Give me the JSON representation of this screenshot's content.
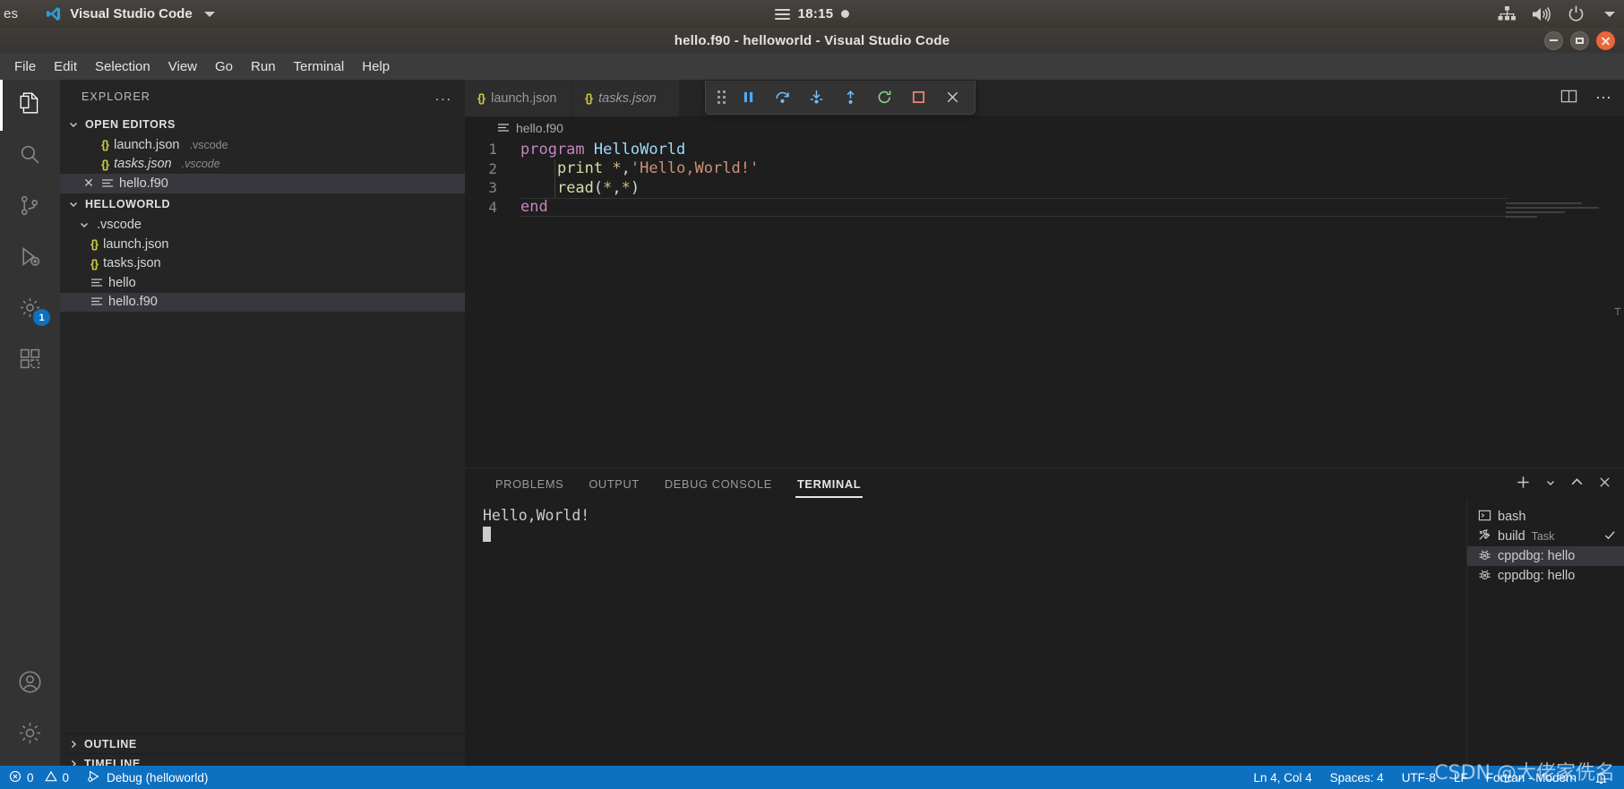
{
  "gnome_panel": {
    "activities": "es",
    "app_name": "Visual Studio Code",
    "clock": "18:15",
    "icons": [
      "network-icon",
      "volume-icon",
      "power-icon",
      "caret-down-icon"
    ]
  },
  "window": {
    "title": "hello.f90 - helloworld - Visual Studio Code",
    "controls": [
      "minimize-button",
      "maximize-button",
      "close-button"
    ]
  },
  "menubar": {
    "items": [
      "File",
      "Edit",
      "Selection",
      "View",
      "Go",
      "Run",
      "Terminal",
      "Help"
    ]
  },
  "activitybar": {
    "items": [
      {
        "name": "explorer",
        "icon": "files-icon",
        "active": true,
        "badge": ""
      },
      {
        "name": "search",
        "icon": "search-icon",
        "active": false,
        "badge": ""
      },
      {
        "name": "source-control",
        "icon": "source-control-icon",
        "active": false,
        "badge": ""
      },
      {
        "name": "run-and-debug",
        "icon": "debug-icon",
        "active": false,
        "badge": ""
      },
      {
        "name": "extensions-settings",
        "icon": "gear-badge-icon",
        "active": false,
        "badge": "1"
      },
      {
        "name": "extensions",
        "icon": "extensions-icon",
        "active": false,
        "badge": ""
      }
    ],
    "bottom": [
      {
        "name": "accounts",
        "icon": "account-icon"
      },
      {
        "name": "manage",
        "icon": "gear-icon"
      }
    ]
  },
  "sidebar": {
    "header_title": "EXPLORER",
    "header_more": "...",
    "open_editors": {
      "label": "OPEN EDITORS",
      "items": [
        {
          "icon": "json-icon",
          "name": "launch.json",
          "dim": ".vscode",
          "italic": false,
          "selected": false,
          "has_close": false
        },
        {
          "icon": "json-icon",
          "name": "tasks.json",
          "dim": ".vscode",
          "italic": true,
          "selected": false,
          "has_close": false
        },
        {
          "icon": "file-icon",
          "name": "hello.f90",
          "dim": "",
          "italic": false,
          "selected": true,
          "has_close": true
        }
      ]
    },
    "workspace": {
      "label": "HELLOWORLD",
      "items": [
        {
          "icon": "folder-open",
          "name": ".vscode",
          "indent": 1,
          "selected": false
        },
        {
          "icon": "json-icon",
          "name": "launch.json",
          "indent": 2,
          "selected": false
        },
        {
          "icon": "json-icon",
          "name": "tasks.json",
          "indent": 2,
          "selected": false
        },
        {
          "icon": "file-icon",
          "name": "hello",
          "indent": 1,
          "selected": false
        },
        {
          "icon": "file-icon",
          "name": "hello.f90",
          "indent": 1,
          "selected": true
        }
      ]
    },
    "collapsed_sections": [
      "OUTLINE",
      "TIMELINE"
    ]
  },
  "editor": {
    "tabs": [
      {
        "label": "launch.json",
        "icon": "json-icon",
        "active": false,
        "italic": false
      },
      {
        "label": "tasks.json",
        "icon": "json-icon",
        "active": false,
        "italic": true
      }
    ],
    "actions": [
      "split-editor-icon",
      "more-actions-icon"
    ],
    "breadcrumb": "hello.f90",
    "breadcrumb_icon": "file-icon",
    "debug_toolbar": {
      "buttons": [
        {
          "name": "drag-handle",
          "icon": "grip-icon"
        },
        {
          "name": "pause-button",
          "icon": "pause-icon",
          "color": "#4daafc"
        },
        {
          "name": "step-over-button",
          "icon": "step-over-icon",
          "color": "#75beff"
        },
        {
          "name": "step-into-button",
          "icon": "step-into-icon",
          "color": "#75beff"
        },
        {
          "name": "step-out-button",
          "icon": "step-out-icon",
          "color": "#75beff"
        },
        {
          "name": "restart-button",
          "icon": "restart-icon",
          "color": "#89d185"
        },
        {
          "name": "stop-button",
          "icon": "stop-icon",
          "color": "#f48771"
        },
        {
          "name": "close-button",
          "icon": "close-icon",
          "color": "#cccccc"
        }
      ]
    },
    "code_lines": [
      {
        "num": "1",
        "tokens": [
          {
            "t": "program",
            "c": "kw"
          },
          {
            "t": " ",
            "c": "punc"
          },
          {
            "t": "HelloWorld",
            "c": "id"
          }
        ]
      },
      {
        "num": "2",
        "tokens": [
          {
            "t": "    ",
            "c": "punc"
          },
          {
            "t": "print",
            "c": "fn"
          },
          {
            "t": " ",
            "c": "punc"
          },
          {
            "t": "*",
            "c": "num"
          },
          {
            "t": ",",
            "c": "punc"
          },
          {
            "t": "'Hello,World!'",
            "c": "str"
          }
        ]
      },
      {
        "num": "3",
        "tokens": [
          {
            "t": "    ",
            "c": "punc"
          },
          {
            "t": "read",
            "c": "fn"
          },
          {
            "t": "(",
            "c": "punc"
          },
          {
            "t": "*",
            "c": "num"
          },
          {
            "t": ",",
            "c": "punc"
          },
          {
            "t": "*",
            "c": "num"
          },
          {
            "t": ")",
            "c": "punc"
          }
        ]
      },
      {
        "num": "4",
        "tokens": [
          {
            "t": "end",
            "c": "kw"
          }
        ]
      }
    ]
  },
  "panel": {
    "tabs": [
      {
        "label": "PROBLEMS",
        "active": false
      },
      {
        "label": "OUTPUT",
        "active": false
      },
      {
        "label": "DEBUG CONSOLE",
        "active": false
      },
      {
        "label": "TERMINAL",
        "active": true
      }
    ],
    "actions": [
      "new-terminal-icon",
      "terminal-dropdown-icon",
      "maximize-panel-icon",
      "close-panel-icon"
    ],
    "terminal_output": [
      "Hello,World!"
    ],
    "terminal_list": [
      {
        "icon": "terminal-bash-icon",
        "name": "bash",
        "sub": "",
        "selected": false,
        "check": false
      },
      {
        "icon": "tools-icon",
        "name": "build",
        "sub": "Task",
        "selected": false,
        "check": true
      },
      {
        "icon": "debug-bug-icon",
        "name": "cppdbg: hello",
        "sub": "",
        "selected": true,
        "check": false
      },
      {
        "icon": "debug-bug-icon",
        "name": "cppdbg: hello",
        "sub": "",
        "selected": false,
        "check": false
      }
    ]
  },
  "statusbar": {
    "errors": "0",
    "warnings": "0",
    "debug_label": "Debug (helloworld)",
    "position": "Ln 4, Col 4",
    "indent": "Spaces: 4",
    "encoding": "UTF-8",
    "eol": "LF",
    "language": "Fortran - Modern",
    "bell_icon": "bell-icon",
    "watermark": "CSDN @大佬家侁名",
    "accent_color": "#0e70c0"
  }
}
